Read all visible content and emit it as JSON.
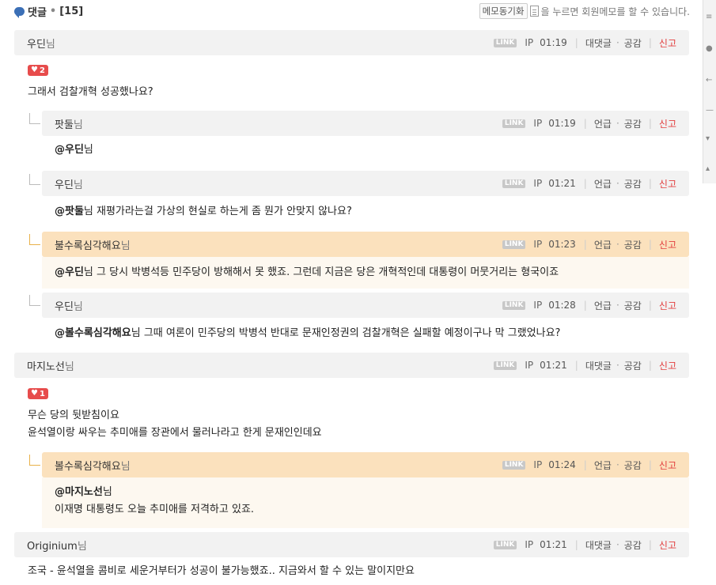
{
  "header": {
    "title": "댓글",
    "dot": "•",
    "count": "[15]",
    "memo_button": "메모동기화",
    "memo_text": "을 누르면 회원메모를 할 수 있습니다."
  },
  "labels": {
    "link": "LINK",
    "ip": "IP",
    "reply": "대댓글",
    "mention": "언급",
    "empathy": "공감",
    "report": "신고",
    "dot": "·",
    "sep": "|",
    "nim": "님"
  },
  "comments": [
    {
      "nick": "우딘",
      "time": "01:19",
      "likes": "2",
      "lines": [
        "그래서 검찰개혁 성공했나요?"
      ]
    },
    {
      "nick": "팟둘",
      "time": "01:19",
      "mention": "@우딘",
      "mention_suffix": "님",
      "lines": [
        ""
      ]
    },
    {
      "nick": "우딘",
      "time": "01:21",
      "mention": "@팟둘",
      "text": "님 재평가라는걸 가상의 현실로 하는게 좀 뭔가 안맞지 않나요?"
    },
    {
      "nick": "불수록심각해요",
      "time": "01:23",
      "mention": "@우딘",
      "text": "님 그 당시 박병석등 민주당이 방해해서 못 했죠. 그런데 지금은 당은 개혁적인데 대통령이 머뭇거리는 형국이죠"
    },
    {
      "nick": "우딘",
      "time": "01:28",
      "mention": "@볼수록심각해요",
      "text": "님 그때 여론이 민주당의 박병석 반대로 문재인정권의 검찰개혁은 실패할 예정이구나 막 그랬었나요?"
    },
    {
      "nick": "마지노선",
      "time": "01:21",
      "likes": "1",
      "lines": [
        "무슨 당의 뒷받침이요",
        "윤석열이랑 싸우는 추미애를 장관에서 물러나라고 한게 문재인인데요"
      ]
    },
    {
      "nick": "볼수록심각해요",
      "time": "01:24",
      "mention": "@마지노선",
      "mention_suffix": "님",
      "text": "이재명 대통령도 오늘 추미애를 저격하고 있죠."
    },
    {
      "nick": "Originium",
      "time": "01:21",
      "lines": [
        "조국 - 윤석열을 콤비로 세운거부터가 성공이 불가능했죠.. 지금와서 할 수 있는 말이지만요"
      ]
    }
  ]
}
